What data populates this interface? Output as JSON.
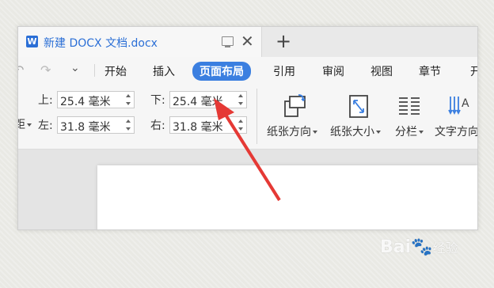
{
  "tab": {
    "title": "新建 DOCX 文档.docx",
    "app_icon_letter": "W"
  },
  "toolbar": {
    "new_tab_label": "+"
  },
  "menu": {
    "items": [
      "开始",
      "插入",
      "页面布局",
      "引用",
      "审阅",
      "视图",
      "章节",
      "开"
    ],
    "active": "页面布局"
  },
  "margins": {
    "top_label": "上:",
    "top_value": "25.4 毫米",
    "bottom_label": "下:",
    "bottom_value": "25.4 毫米",
    "left_label": "左:",
    "left_value": "31.8 毫米",
    "right_label": "右:",
    "right_value": "31.8 毫米",
    "cut_label": "距"
  },
  "ribbon": {
    "orientation_label": "纸张方向",
    "size_label": "纸张大小",
    "columns_label": "分栏",
    "text_direction_label": "文字方向"
  },
  "watermark": {
    "brand": "Bai",
    "suffix": "经验"
  },
  "colors": {
    "accent": "#3b7fe0",
    "arrow": "#e53935"
  }
}
